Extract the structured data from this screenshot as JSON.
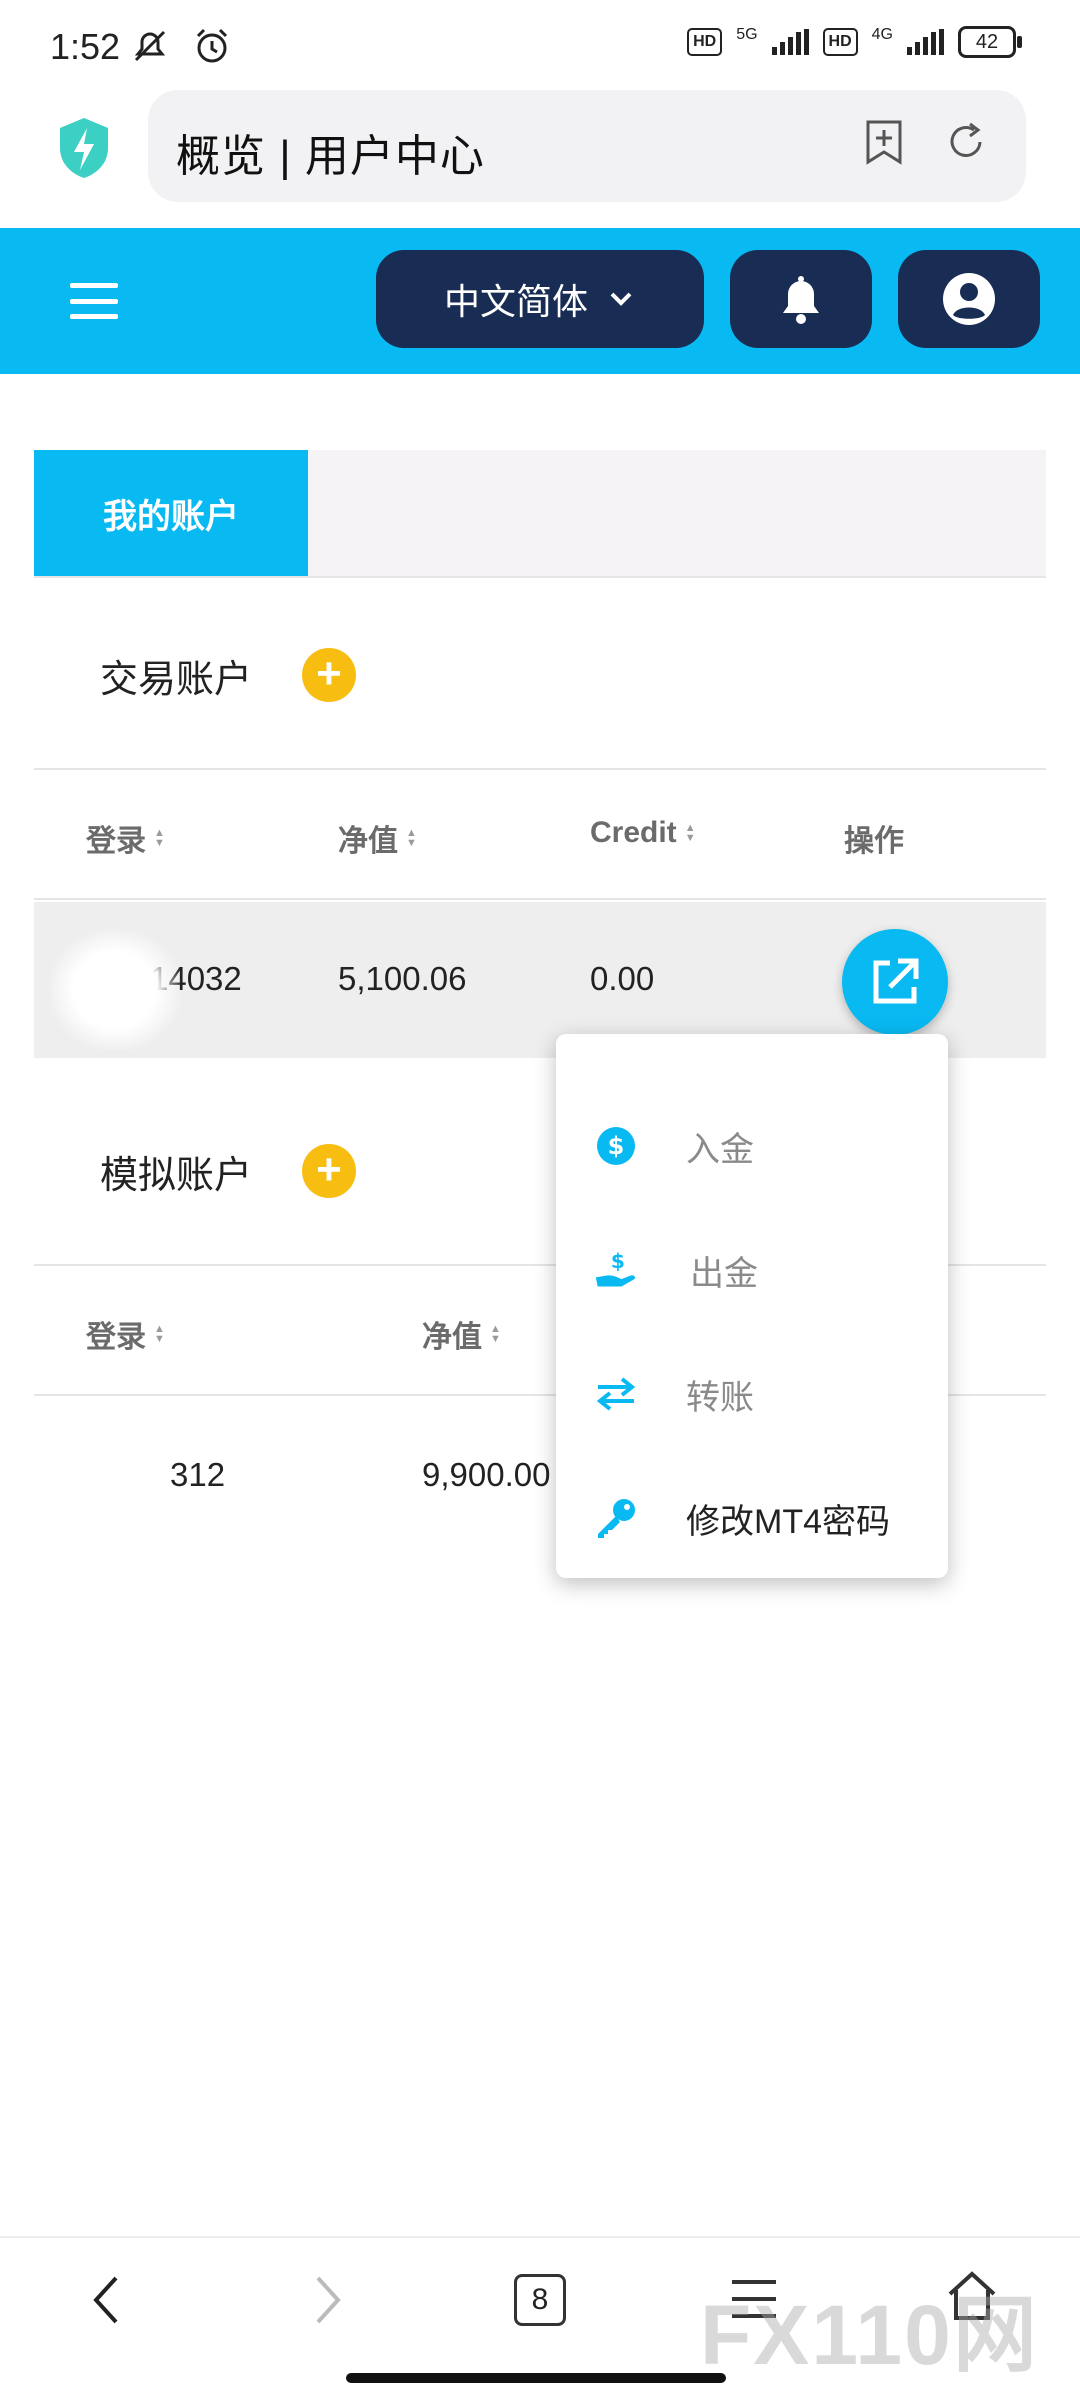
{
  "status_bar": {
    "time": "1:52",
    "net1": "5G",
    "net2": "4G",
    "hd": "HD",
    "battery": "42"
  },
  "browser": {
    "url_title": "概览 | 用户中心"
  },
  "header": {
    "language": "中文简体"
  },
  "tabs": {
    "active": "我的账户"
  },
  "trading": {
    "title": "交易账户",
    "columns": [
      "登录",
      "净值",
      "Credit",
      "操作"
    ],
    "row": {
      "login": "14032",
      "equity": "5,100.06",
      "credit": "0.00"
    }
  },
  "demo": {
    "title": "模拟账户",
    "columns": [
      "登录",
      "净值"
    ],
    "row": {
      "login": "312",
      "equity": "9,900.00"
    }
  },
  "menu": {
    "items": [
      {
        "label": "入金",
        "icon": "dollar-circle-icon"
      },
      {
        "label": "出金",
        "icon": "hand-dollar-icon"
      },
      {
        "label": "转账",
        "icon": "transfer-arrows-icon"
      },
      {
        "label": "修改MT4密码",
        "icon": "key-icon"
      }
    ]
  },
  "bottom_nav": {
    "tab_count": "8",
    "watermark": "FX110网"
  },
  "colors": {
    "accent": "#08b9f2",
    "navy": "#182c54",
    "plus": "#f7bd10"
  }
}
